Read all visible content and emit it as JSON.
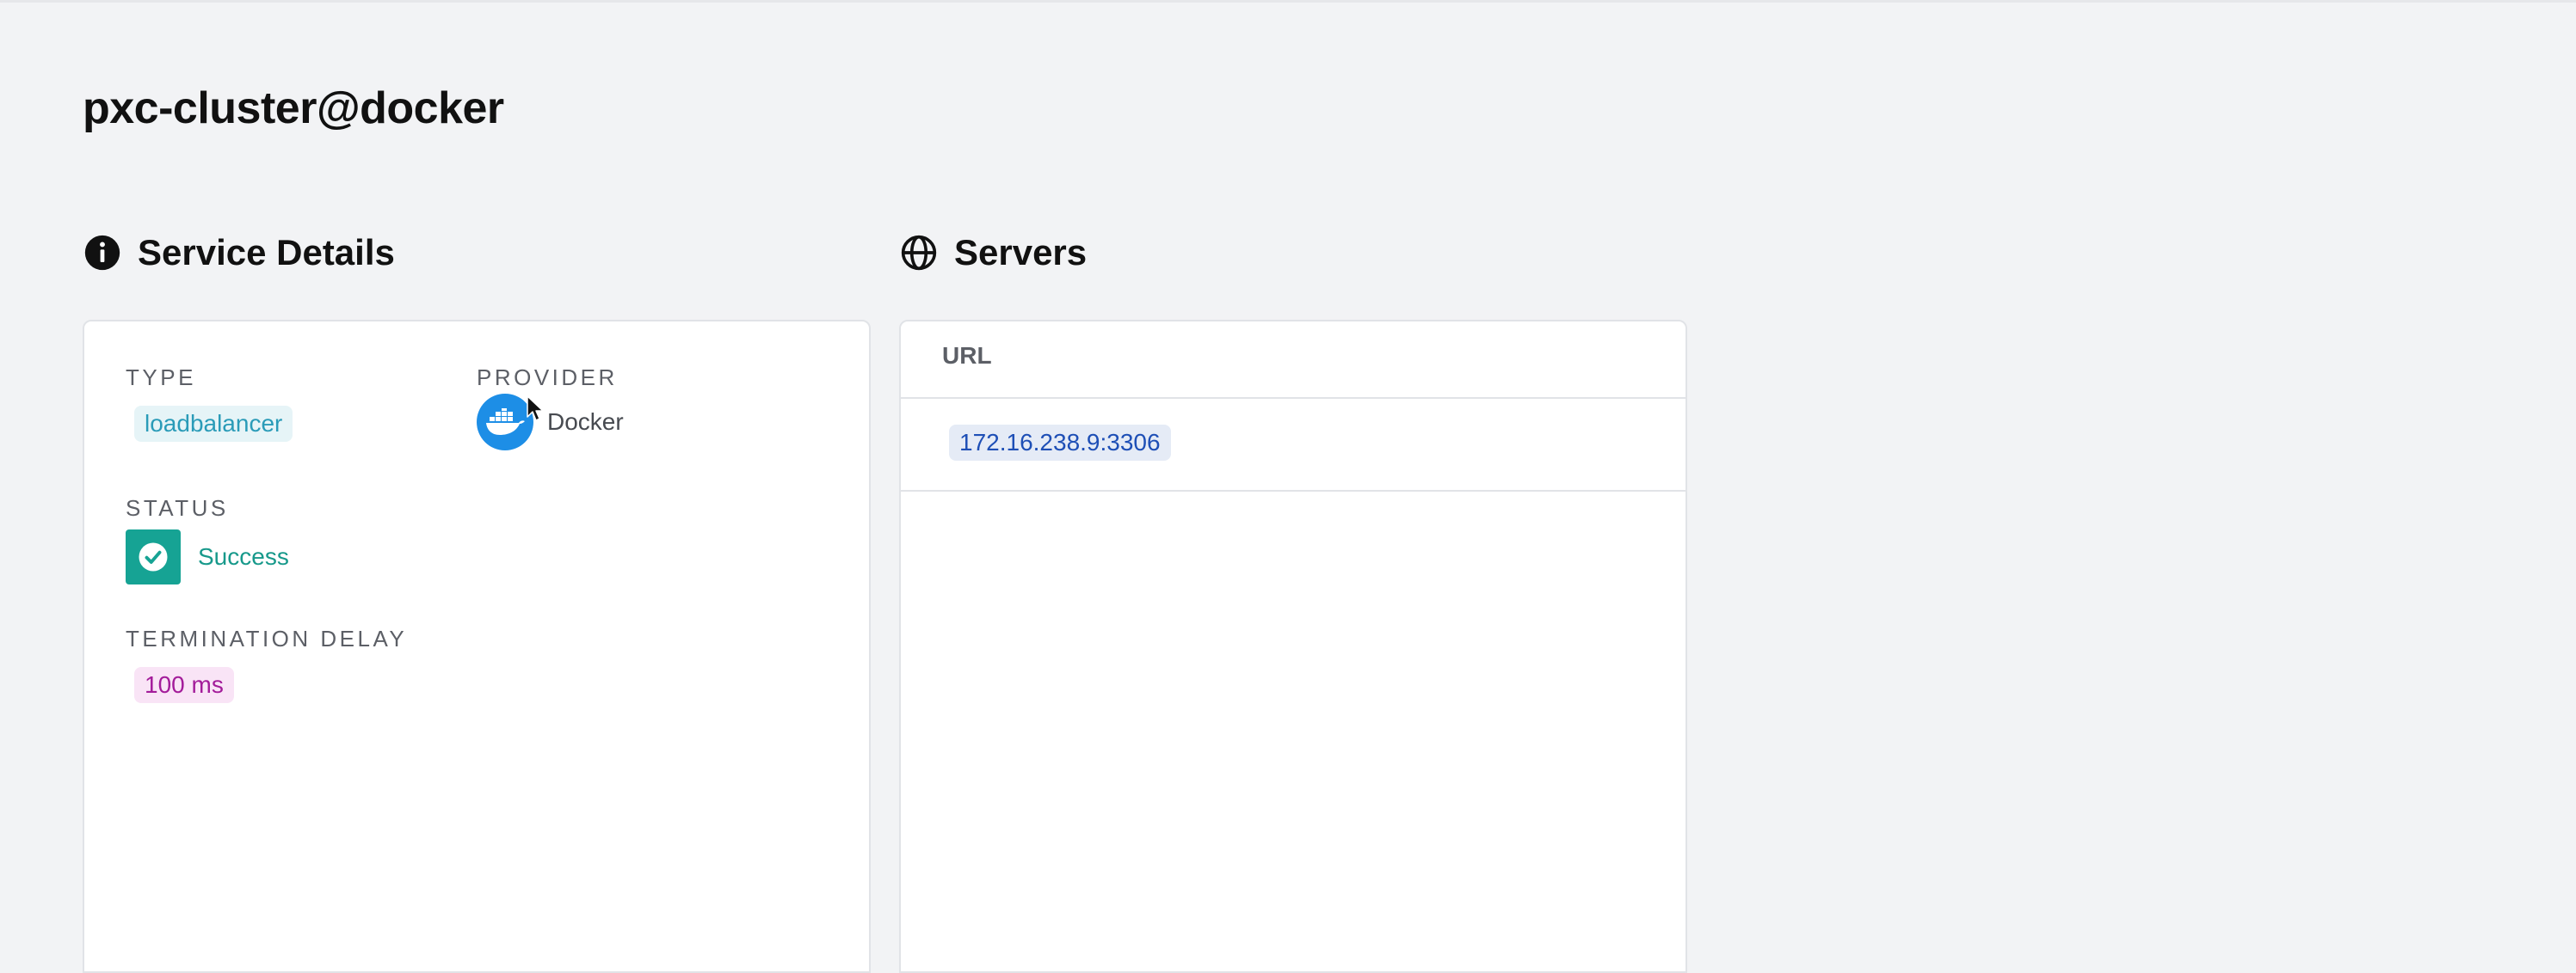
{
  "page": {
    "title": "pxc-cluster@docker"
  },
  "service_details": {
    "heading": "Service Details",
    "icon": "info-icon",
    "type": {
      "label": "TYPE",
      "value": "loadbalancer"
    },
    "provider": {
      "label": "PROVIDER",
      "name": "Docker",
      "icon": "docker-icon"
    },
    "status": {
      "label": "STATUS",
      "value": "Success",
      "icon": "check-icon"
    },
    "termination_delay": {
      "label": "TERMINATION DELAY",
      "value": "100 ms"
    }
  },
  "servers": {
    "heading": "Servers",
    "icon": "globe-icon",
    "column_header": "URL",
    "rows": [
      {
        "url": "172.16.238.9:3306"
      }
    ]
  },
  "colors": {
    "background": "#f2f3f5",
    "type_chip": "#2a9bb8",
    "success": "#16a394",
    "delay_chip": "#a31c9a",
    "url_chip": "#1e4fb6",
    "docker_blue": "#1d8ee6"
  }
}
